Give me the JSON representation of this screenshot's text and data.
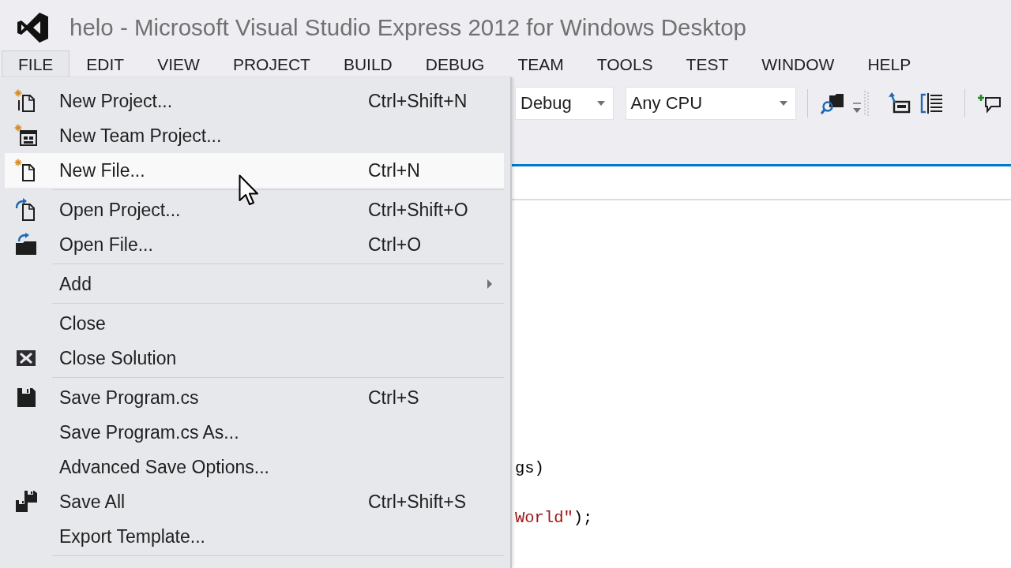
{
  "window": {
    "title": "helo - Microsoft Visual Studio Express 2012 for Windows Desktop"
  },
  "menu_bar": [
    {
      "label": "FILE",
      "selected": true
    },
    {
      "label": "EDIT",
      "selected": false
    },
    {
      "label": "VIEW",
      "selected": false
    },
    {
      "label": "PROJECT",
      "selected": false
    },
    {
      "label": "BUILD",
      "selected": false
    },
    {
      "label": "DEBUG",
      "selected": false
    },
    {
      "label": "TEAM",
      "selected": false
    },
    {
      "label": "TOOLS",
      "selected": false
    },
    {
      "label": "TEST",
      "selected": false
    },
    {
      "label": "WINDOW",
      "selected": false
    },
    {
      "label": "HELP",
      "selected": false
    }
  ],
  "toolbar": {
    "configuration": "Debug",
    "platform": "Any CPU"
  },
  "file_menu": {
    "sections": [
      [
        {
          "label": "New Project...",
          "shortcut": "Ctrl+Shift+N",
          "highlighted": false,
          "submenu": false
        },
        {
          "label": "New Team Project...",
          "highlighted": false,
          "submenu": false
        },
        {
          "label": "New File...",
          "shortcut": "Ctrl+N",
          "highlighted": true,
          "submenu": false
        }
      ],
      [
        {
          "label": "Open Project...",
          "shortcut": "Ctrl+Shift+O",
          "highlighted": false,
          "submenu": false
        },
        {
          "label": "Open File...",
          "shortcut": "Ctrl+O",
          "highlighted": false,
          "submenu": false
        }
      ],
      [
        {
          "label": "Add",
          "highlighted": false,
          "submenu": true
        }
      ],
      [
        {
          "label": "Close",
          "highlighted": false,
          "submenu": false
        },
        {
          "label": "Close Solution",
          "highlighted": false,
          "submenu": false
        }
      ],
      [
        {
          "label": "Save Program.cs",
          "shortcut": "Ctrl+S",
          "highlighted": false,
          "submenu": false
        },
        {
          "label": "Save Program.cs As...",
          "highlighted": false,
          "submenu": false
        },
        {
          "label": "Advanced Save Options...",
          "highlighted": false,
          "submenu": false
        },
        {
          "label": "Save All",
          "shortcut": "Ctrl+Shift+S",
          "highlighted": false,
          "submenu": false
        },
        {
          "label": "Export Template...",
          "highlighted": false,
          "submenu": false
        }
      ]
    ]
  },
  "editor": {
    "lines": [
      [
        {
          "text": "gs)",
          "kind": "plain"
        }
      ],
      [
        {
          "text": "World\"",
          "kind": "string"
        },
        {
          "text": ");",
          "kind": "plain"
        }
      ]
    ]
  }
}
